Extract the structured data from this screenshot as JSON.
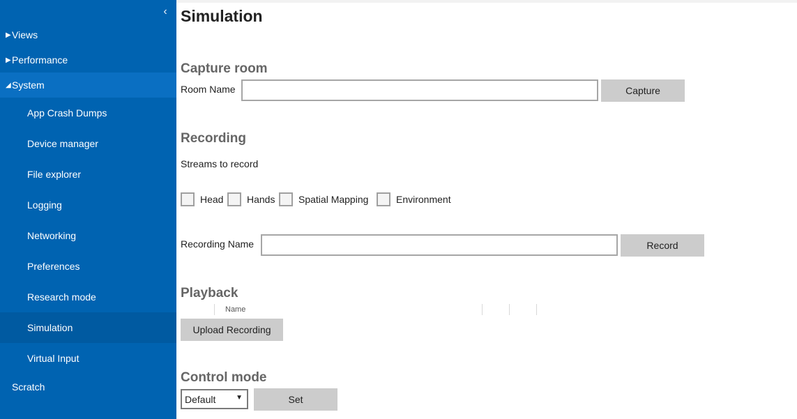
{
  "sidebar": {
    "collapse_glyph": "‹",
    "top_items": [
      {
        "label": "Views",
        "glyph": "▶"
      },
      {
        "label": "Performance",
        "glyph": "▶"
      },
      {
        "label": "System",
        "glyph": "◢"
      }
    ],
    "system_items": [
      {
        "label": "App Crash Dumps"
      },
      {
        "label": "Device manager"
      },
      {
        "label": "File explorer"
      },
      {
        "label": "Logging"
      },
      {
        "label": "Networking"
      },
      {
        "label": "Preferences"
      },
      {
        "label": "Research mode"
      },
      {
        "label": "Simulation",
        "active": true
      },
      {
        "label": "Virtual Input"
      }
    ],
    "scratch_label": "Scratch",
    "colors": {
      "background": "#0063b1",
      "active": "#005aa1"
    }
  },
  "main": {
    "title": "Simulation",
    "capture": {
      "heading": "Capture room",
      "room_name_label": "Room Name",
      "room_name_value": "",
      "button": "Capture"
    },
    "recording": {
      "heading": "Recording",
      "streams_label": "Streams to record",
      "streams": [
        {
          "label": "Head",
          "checked": false
        },
        {
          "label": "Hands",
          "checked": false
        },
        {
          "label": "Spatial Mapping",
          "checked": false
        },
        {
          "label": "Environment",
          "checked": false
        }
      ],
      "name_label": "Recording Name",
      "name_value": "",
      "button": "Record"
    },
    "playback": {
      "heading": "Playback",
      "table_columns": [
        "Name"
      ],
      "upload_button": "Upload Recording"
    },
    "control_mode": {
      "heading": "Control mode",
      "selected": "Default",
      "set_button": "Set"
    }
  }
}
